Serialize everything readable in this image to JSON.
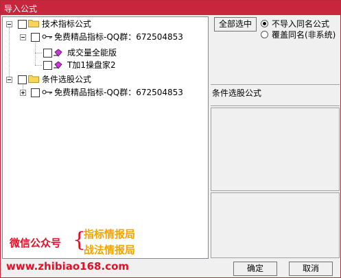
{
  "window": {
    "title": "导入公式"
  },
  "tree": {
    "root1": {
      "label": "技术指标公式"
    },
    "child1": {
      "label": "免费精品指标-QQ群：672504853"
    },
    "leaf1": {
      "label": "成交量全能版"
    },
    "leaf2": {
      "label": "T加1操盘家2"
    },
    "root2": {
      "label": "条件选股公式"
    },
    "child2": {
      "label": "免费精品指标-QQ群：672504853"
    }
  },
  "options": {
    "select_all_label": "全部选中",
    "no_import_label": "不导入同名公式",
    "overwrite_label": "覆盖同名(非系统)"
  },
  "info_panel": {
    "label": "条件选股公式"
  },
  "watermark": {
    "wechat": "微信公众号",
    "line1": "指标情报局",
    "line2": "战法情报局",
    "url": "www.zhibiao168.com"
  },
  "buttons": {
    "ok": "确定",
    "cancel": "取消"
  },
  "colors": {
    "titlebar": "#c7263d",
    "watermark_red": "#e0112a",
    "watermark_orange": "#f4a300"
  }
}
